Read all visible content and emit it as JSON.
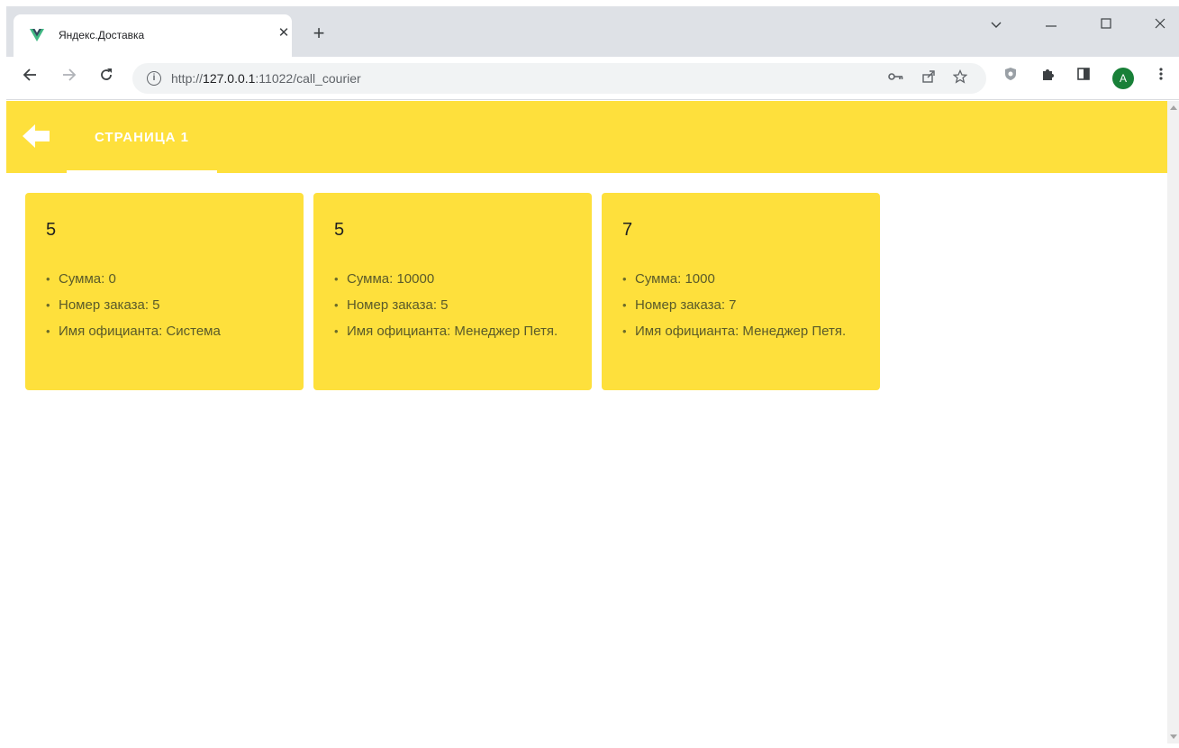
{
  "browser": {
    "tab_title": "Яндекс.Доставка",
    "tab_close": "✕",
    "new_tab": "+",
    "url_scheme": "http://",
    "url_host": "127.0.0.1",
    "url_rest": ":11022/call_courier",
    "avatar_letter": "A",
    "favicon_color": "#41b883",
    "favicon_dark": "#34495e"
  },
  "appbar": {
    "background": "#fee03c",
    "tab_label": "СТРАНИЦА 1"
  },
  "cards": [
    {
      "title": "5",
      "items": [
        "Сумма: 0",
        "Номер заказа: 5",
        "Имя официанта: Система"
      ]
    },
    {
      "title": "5",
      "items": [
        "Сумма: 10000",
        "Номер заказа: 5",
        "Имя официанта: Менеджер Петя."
      ]
    },
    {
      "title": "7",
      "items": [
        "Сумма: 1000",
        "Номер заказа: 7",
        "Имя официанта: Менеджер Петя."
      ]
    }
  ]
}
